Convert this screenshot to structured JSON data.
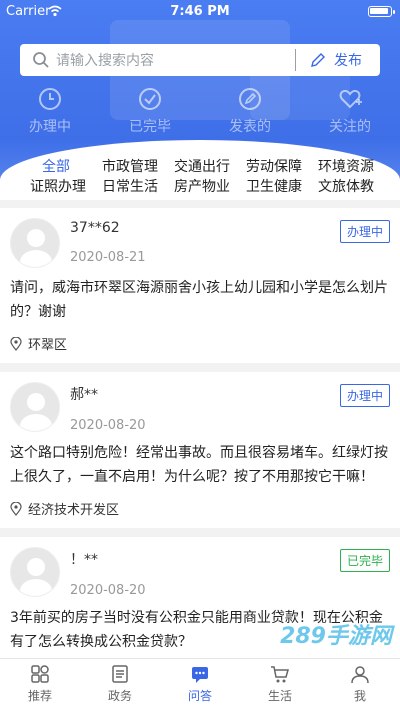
{
  "status": {
    "carrier": "Carrier",
    "time": "7:46 PM"
  },
  "search": {
    "placeholder": "请输入搜索内容",
    "publish": "发布"
  },
  "quick": [
    {
      "label": "办理中",
      "icon": "clock-icon"
    },
    {
      "label": "已完毕",
      "icon": "check-circle-icon"
    },
    {
      "label": "发表的",
      "icon": "edit-icon"
    },
    {
      "label": "关注的",
      "icon": "heart-plus-icon"
    }
  ],
  "categories": [
    "全部",
    "市政管理",
    "交通出行",
    "劳动保障",
    "环境资源",
    "证照办理",
    "日常生活",
    "房产物业",
    "卫生健康",
    "文旅体教"
  ],
  "posts": [
    {
      "user": "37**62",
      "date": "2020-08-21",
      "status": "办理中",
      "content": "请问，威海市环翠区海源丽舍小孩上幼儿园和小学是怎么划片的？谢谢",
      "location": "环翠区"
    },
    {
      "user": "郝**",
      "date": "2020-08-20",
      "status": "办理中",
      "content": "这个路口特别危险！经常出事故。而且很容易堵车。红绿灯按上很久了，一直不启用！为什么呢？按了不用那按它干嘛！",
      "location": "经济技术开发区"
    },
    {
      "user": "！**",
      "date": "2020-08-20",
      "status": "已完毕",
      "content": "3年前买的房子当时没有公积金只能用商业贷款！现在公积金有了怎么转换成公积金贷款？"
    }
  ],
  "tabs": [
    {
      "label": "推荐",
      "icon": "grid-icon"
    },
    {
      "label": "政务",
      "icon": "document-icon"
    },
    {
      "label": "问答",
      "icon": "chat-icon"
    },
    {
      "label": "生活",
      "icon": "cart-icon"
    },
    {
      "label": "我",
      "icon": "user-icon"
    }
  ],
  "watermark": "289手游网",
  "colors": {
    "primary": "#3a67e6",
    "done": "#2db04d"
  }
}
